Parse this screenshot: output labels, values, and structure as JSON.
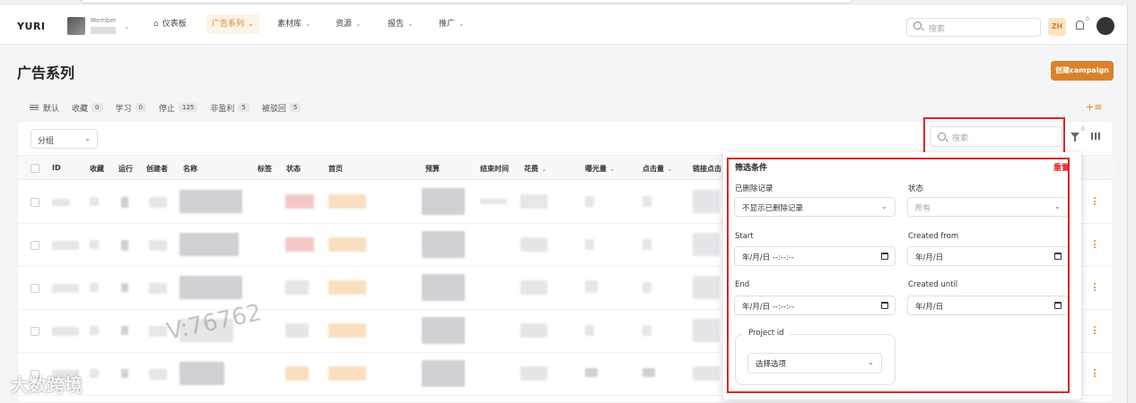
{
  "nav": {
    "brand": "YURI",
    "member_label": "Member",
    "items": [
      {
        "label": "仪表板"
      },
      {
        "label": "广告系列"
      },
      {
        "label": "素材库"
      },
      {
        "label": "资源"
      },
      {
        "label": "报告"
      },
      {
        "label": "推广"
      }
    ],
    "search_placeholder": "搜索",
    "lang": "ZH",
    "notification_count": "0"
  },
  "page": {
    "title": "广告系列",
    "create_button": "创建campaign"
  },
  "views": [
    {
      "label": "默认",
      "count": ""
    },
    {
      "label": "收藏",
      "count": "0"
    },
    {
      "label": "学习",
      "count": "0"
    },
    {
      "label": "停止",
      "count": "125"
    },
    {
      "label": "非盈利",
      "count": "5"
    },
    {
      "label": "被驳回",
      "count": "5"
    }
  ],
  "toolbar": {
    "group_value": "分组",
    "search_placeholder": "搜索",
    "filter_count": "0"
  },
  "table": {
    "columns": [
      "ID",
      "收藏",
      "运行",
      "创建者",
      "名称",
      "标签",
      "状态",
      "首页",
      "预算",
      "结束时间",
      "花费",
      "曝光量",
      "点击量",
      "链接点击"
    ]
  },
  "filter": {
    "title": "筛选条件",
    "reset": "重置",
    "deleted_label": "已删除记录",
    "deleted_value": "不显示已删除记录",
    "status_label": "状态",
    "status_value": "所有",
    "start_label": "Start",
    "start_value": "年/月/日 --:--:--",
    "created_from_label": "Created from",
    "created_from_value": "年/月/日",
    "end_label": "End",
    "end_value": "年/月/日 --:--:--",
    "created_until_label": "Created until",
    "created_until_value": "年/月/日",
    "project_label": "Project id",
    "project_value": "选择选项"
  },
  "watermarks": {
    "id": "V:76762",
    "brand": "大数跨境"
  },
  "colors": {
    "accent": "#d9822b",
    "highlight": "#e02424"
  }
}
